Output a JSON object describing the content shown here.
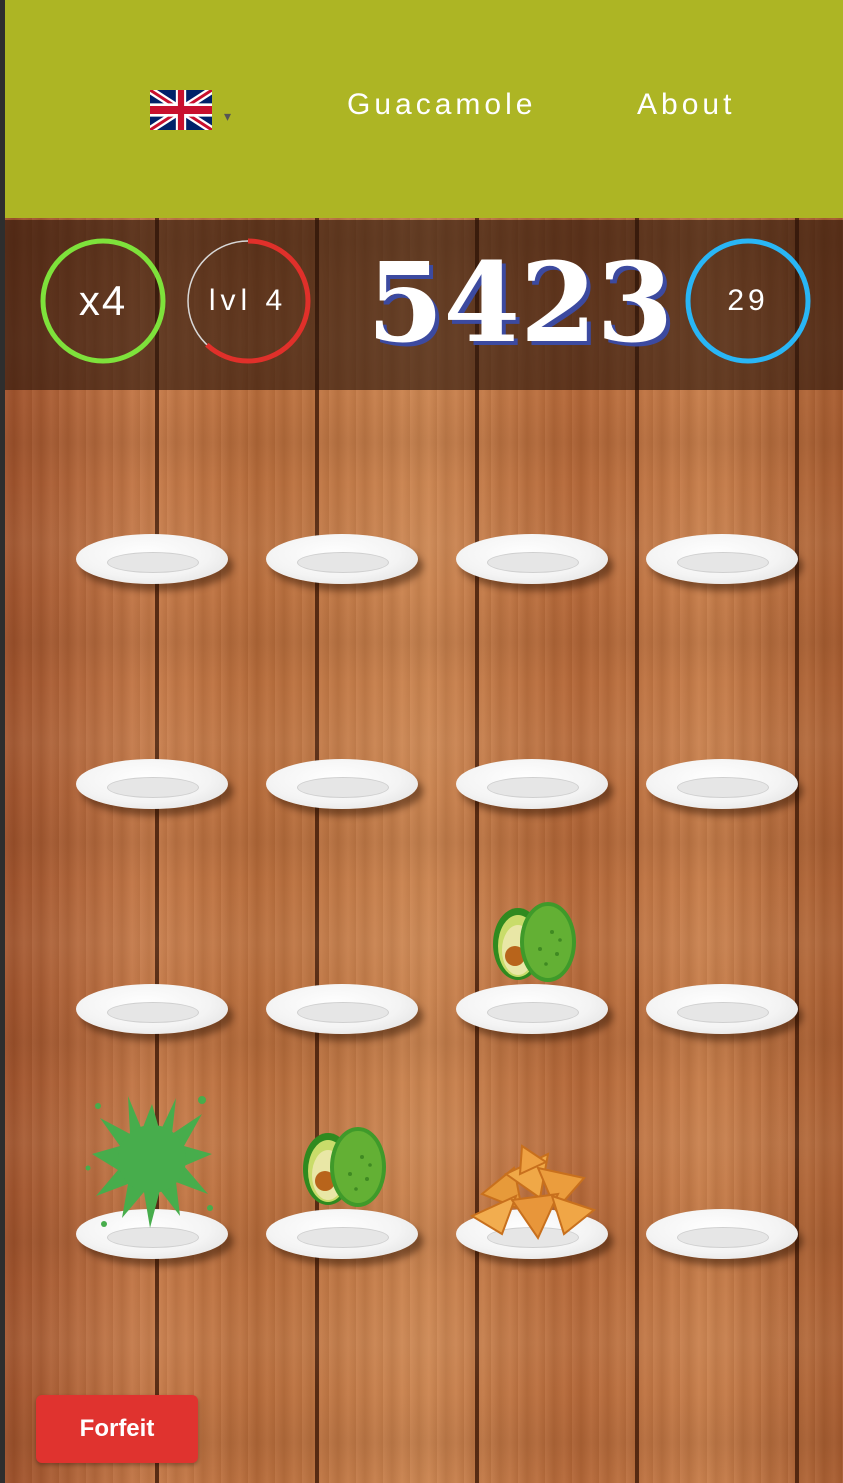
{
  "navbar": {
    "language_icon": "uk-flag-icon",
    "language_caret": "▾",
    "links": [
      "Guacamole",
      "About"
    ]
  },
  "stats": {
    "multiplier": "x4",
    "level": "lvl 4",
    "level_progress": 0.62,
    "score": "5423",
    "timer": "29"
  },
  "colors": {
    "navbar": "#adb524",
    "multiplier_ring": "#7ee23b",
    "level_ring": "#e0302a",
    "timer_ring": "#29b6f6",
    "forfeit_button": "#e0332f"
  },
  "board": {
    "rows": 4,
    "cols": 4,
    "cells": [
      "empty",
      "empty",
      "empty",
      "empty",
      "empty",
      "empty",
      "empty",
      "empty",
      "empty",
      "empty",
      "avocado",
      "empty",
      "splat",
      "avocado",
      "chips",
      "empty"
    ]
  },
  "forfeit_label": "Forfeit"
}
